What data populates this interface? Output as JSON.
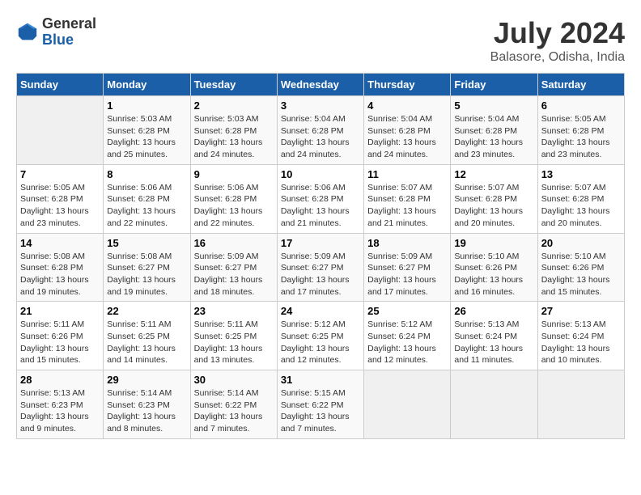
{
  "header": {
    "logo_general": "General",
    "logo_blue": "Blue",
    "month_year": "July 2024",
    "location": "Balasore, Odisha, India"
  },
  "days_of_week": [
    "Sunday",
    "Monday",
    "Tuesday",
    "Wednesday",
    "Thursday",
    "Friday",
    "Saturday"
  ],
  "weeks": [
    [
      {
        "day": "",
        "info": ""
      },
      {
        "day": "1",
        "info": "Sunrise: 5:03 AM\nSunset: 6:28 PM\nDaylight: 13 hours\nand 25 minutes."
      },
      {
        "day": "2",
        "info": "Sunrise: 5:03 AM\nSunset: 6:28 PM\nDaylight: 13 hours\nand 24 minutes."
      },
      {
        "day": "3",
        "info": "Sunrise: 5:04 AM\nSunset: 6:28 PM\nDaylight: 13 hours\nand 24 minutes."
      },
      {
        "day": "4",
        "info": "Sunrise: 5:04 AM\nSunset: 6:28 PM\nDaylight: 13 hours\nand 24 minutes."
      },
      {
        "day": "5",
        "info": "Sunrise: 5:04 AM\nSunset: 6:28 PM\nDaylight: 13 hours\nand 23 minutes."
      },
      {
        "day": "6",
        "info": "Sunrise: 5:05 AM\nSunset: 6:28 PM\nDaylight: 13 hours\nand 23 minutes."
      }
    ],
    [
      {
        "day": "7",
        "info": "Sunrise: 5:05 AM\nSunset: 6:28 PM\nDaylight: 13 hours\nand 23 minutes."
      },
      {
        "day": "8",
        "info": "Sunrise: 5:06 AM\nSunset: 6:28 PM\nDaylight: 13 hours\nand 22 minutes."
      },
      {
        "day": "9",
        "info": "Sunrise: 5:06 AM\nSunset: 6:28 PM\nDaylight: 13 hours\nand 22 minutes."
      },
      {
        "day": "10",
        "info": "Sunrise: 5:06 AM\nSunset: 6:28 PM\nDaylight: 13 hours\nand 21 minutes."
      },
      {
        "day": "11",
        "info": "Sunrise: 5:07 AM\nSunset: 6:28 PM\nDaylight: 13 hours\nand 21 minutes."
      },
      {
        "day": "12",
        "info": "Sunrise: 5:07 AM\nSunset: 6:28 PM\nDaylight: 13 hours\nand 20 minutes."
      },
      {
        "day": "13",
        "info": "Sunrise: 5:07 AM\nSunset: 6:28 PM\nDaylight: 13 hours\nand 20 minutes."
      }
    ],
    [
      {
        "day": "14",
        "info": "Sunrise: 5:08 AM\nSunset: 6:28 PM\nDaylight: 13 hours\nand 19 minutes."
      },
      {
        "day": "15",
        "info": "Sunrise: 5:08 AM\nSunset: 6:27 PM\nDaylight: 13 hours\nand 19 minutes."
      },
      {
        "day": "16",
        "info": "Sunrise: 5:09 AM\nSunset: 6:27 PM\nDaylight: 13 hours\nand 18 minutes."
      },
      {
        "day": "17",
        "info": "Sunrise: 5:09 AM\nSunset: 6:27 PM\nDaylight: 13 hours\nand 17 minutes."
      },
      {
        "day": "18",
        "info": "Sunrise: 5:09 AM\nSunset: 6:27 PM\nDaylight: 13 hours\nand 17 minutes."
      },
      {
        "day": "19",
        "info": "Sunrise: 5:10 AM\nSunset: 6:26 PM\nDaylight: 13 hours\nand 16 minutes."
      },
      {
        "day": "20",
        "info": "Sunrise: 5:10 AM\nSunset: 6:26 PM\nDaylight: 13 hours\nand 15 minutes."
      }
    ],
    [
      {
        "day": "21",
        "info": "Sunrise: 5:11 AM\nSunset: 6:26 PM\nDaylight: 13 hours\nand 15 minutes."
      },
      {
        "day": "22",
        "info": "Sunrise: 5:11 AM\nSunset: 6:25 PM\nDaylight: 13 hours\nand 14 minutes."
      },
      {
        "day": "23",
        "info": "Sunrise: 5:11 AM\nSunset: 6:25 PM\nDaylight: 13 hours\nand 13 minutes."
      },
      {
        "day": "24",
        "info": "Sunrise: 5:12 AM\nSunset: 6:25 PM\nDaylight: 13 hours\nand 12 minutes."
      },
      {
        "day": "25",
        "info": "Sunrise: 5:12 AM\nSunset: 6:24 PM\nDaylight: 13 hours\nand 12 minutes."
      },
      {
        "day": "26",
        "info": "Sunrise: 5:13 AM\nSunset: 6:24 PM\nDaylight: 13 hours\nand 11 minutes."
      },
      {
        "day": "27",
        "info": "Sunrise: 5:13 AM\nSunset: 6:24 PM\nDaylight: 13 hours\nand 10 minutes."
      }
    ],
    [
      {
        "day": "28",
        "info": "Sunrise: 5:13 AM\nSunset: 6:23 PM\nDaylight: 13 hours\nand 9 minutes."
      },
      {
        "day": "29",
        "info": "Sunrise: 5:14 AM\nSunset: 6:23 PM\nDaylight: 13 hours\nand 8 minutes."
      },
      {
        "day": "30",
        "info": "Sunrise: 5:14 AM\nSunset: 6:22 PM\nDaylight: 13 hours\nand 7 minutes."
      },
      {
        "day": "31",
        "info": "Sunrise: 5:15 AM\nSunset: 6:22 PM\nDaylight: 13 hours\nand 7 minutes."
      },
      {
        "day": "",
        "info": ""
      },
      {
        "day": "",
        "info": ""
      },
      {
        "day": "",
        "info": ""
      }
    ]
  ]
}
